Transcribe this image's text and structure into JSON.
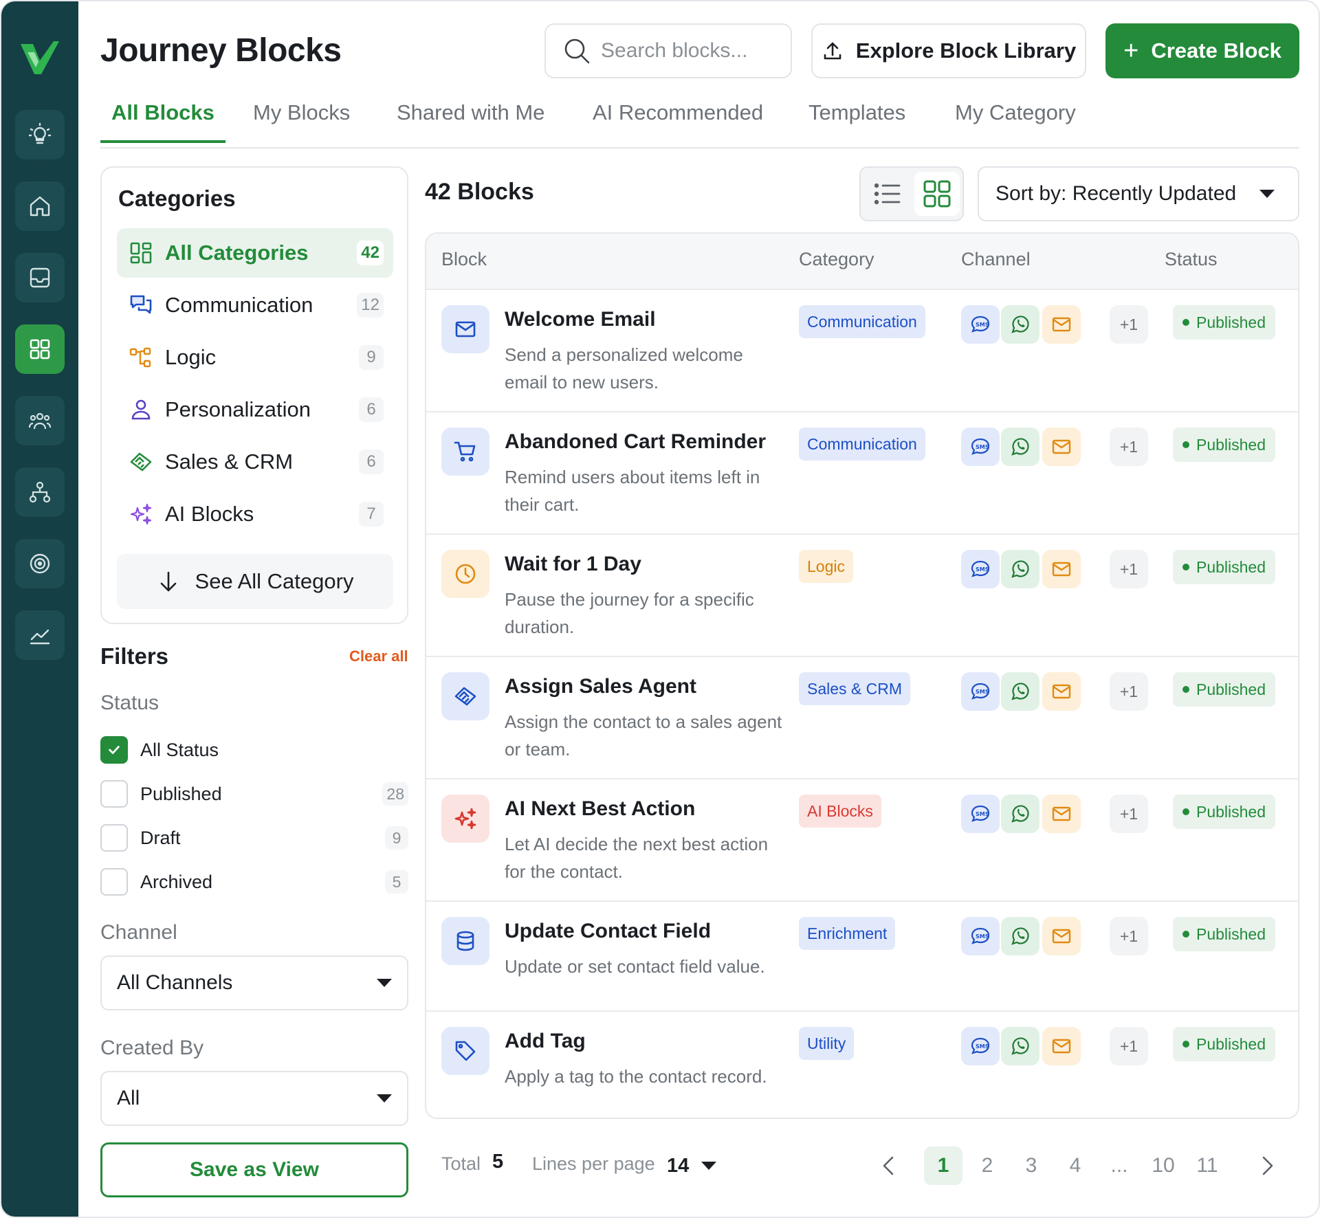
{
  "app": {
    "title": "Journey Blocks",
    "accent": "#238b3a",
    "sidebar_bg": "#143f44"
  },
  "sidebar": {
    "logo": "brand-logo",
    "items": [
      {
        "icon": "lightbulb-icon"
      },
      {
        "icon": "home-icon"
      },
      {
        "icon": "inbox-icon"
      },
      {
        "icon": "grid-icon",
        "active": true
      },
      {
        "icon": "users-icon"
      },
      {
        "icon": "hierarchy-icon"
      },
      {
        "icon": "target-icon"
      },
      {
        "icon": "chart-icon"
      }
    ]
  },
  "header": {
    "search_placeholder": "Search blocks...",
    "explore_label": "Explore Block Library",
    "create_label": "Create Block"
  },
  "tabs": [
    {
      "label": "All Blocks",
      "active": true
    },
    {
      "label": "My Blocks"
    },
    {
      "label": "Shared with Me"
    },
    {
      "label": "AI Recommended"
    },
    {
      "label": "Templates"
    },
    {
      "label": "My Category"
    }
  ],
  "categories": {
    "title": "Categories",
    "items": [
      {
        "label": "All Categories",
        "count": "42",
        "icon": "dashboard-icon",
        "active": true
      },
      {
        "label": "Communication",
        "count": "12",
        "icon": "chat-icon"
      },
      {
        "label": "Logic",
        "count": "9",
        "icon": "flow-icon"
      },
      {
        "label": "Personalization",
        "count": "6",
        "icon": "person-icon"
      },
      {
        "label": "Sales & CRM",
        "count": "6",
        "icon": "handshake-icon"
      },
      {
        "label": "AI Blocks",
        "count": "7",
        "icon": "sparkle-icon"
      }
    ],
    "see_all": "See All Category"
  },
  "filters": {
    "title": "Filters",
    "clear_all": "Clear all",
    "status_label": "Status",
    "status_options": [
      {
        "label": "All Status",
        "checked": true,
        "count": ""
      },
      {
        "label": "Published",
        "checked": false,
        "count": "28"
      },
      {
        "label": "Draft",
        "checked": false,
        "count": "9"
      },
      {
        "label": "Archived",
        "checked": false,
        "count": "5"
      }
    ],
    "channel_label": "Channel",
    "channel_value": "All Channels",
    "created_by_label": "Created By",
    "created_by_value": "All",
    "save_view": "Save as View"
  },
  "blocks": {
    "count_label": "42 Blocks",
    "sort_label": "Sort by: Recently Updated",
    "columns": [
      "Block",
      "Category",
      "Channel",
      "Status"
    ],
    "rows": [
      {
        "name": "Welcome Email",
        "desc": "Send a personalized welcome email to new users.",
        "category": "Communication",
        "icon": "mail-icon",
        "status": "Published",
        "more": "+1"
      },
      {
        "name": "Abandoned Cart Reminder",
        "desc": "Remind users about items left in their cart.",
        "category": "Communication",
        "icon": "cart-icon",
        "status": "Published",
        "more": "+1"
      },
      {
        "name": "Wait for 1 Day",
        "desc": "Pause the journey for a specific duration.",
        "category": "Logic",
        "icon": "clock-icon",
        "status": "Published",
        "more": "+1"
      },
      {
        "name": "Assign Sales Agent",
        "desc": "Assign the contact to a sales agent or team.",
        "category": "Sales & CRM",
        "icon": "handshake-icon",
        "status": "Published",
        "more": "+1"
      },
      {
        "name": "AI Next Best Action",
        "desc": "Let AI decide the next best action for the contact.",
        "category": "AI Blocks",
        "icon": "sparkle-icon",
        "status": "Published",
        "more": "+1"
      },
      {
        "name": "Update Contact Field",
        "desc": "Update or set contact field value.",
        "category": "Enrichment",
        "icon": "database-icon",
        "status": "Published",
        "more": "+1"
      },
      {
        "name": "Add Tag",
        "desc": "Apply a tag to the contact record.",
        "category": "Utility",
        "icon": "tag-icon",
        "status": "Published",
        "more": "+1"
      }
    ]
  },
  "pagination": {
    "total_label": "Total",
    "total": "5",
    "lines_label": "Lines per page",
    "lines": "14",
    "pages": [
      "1",
      "2",
      "3",
      "4",
      "...",
      "10",
      "11"
    ],
    "current": "1"
  }
}
